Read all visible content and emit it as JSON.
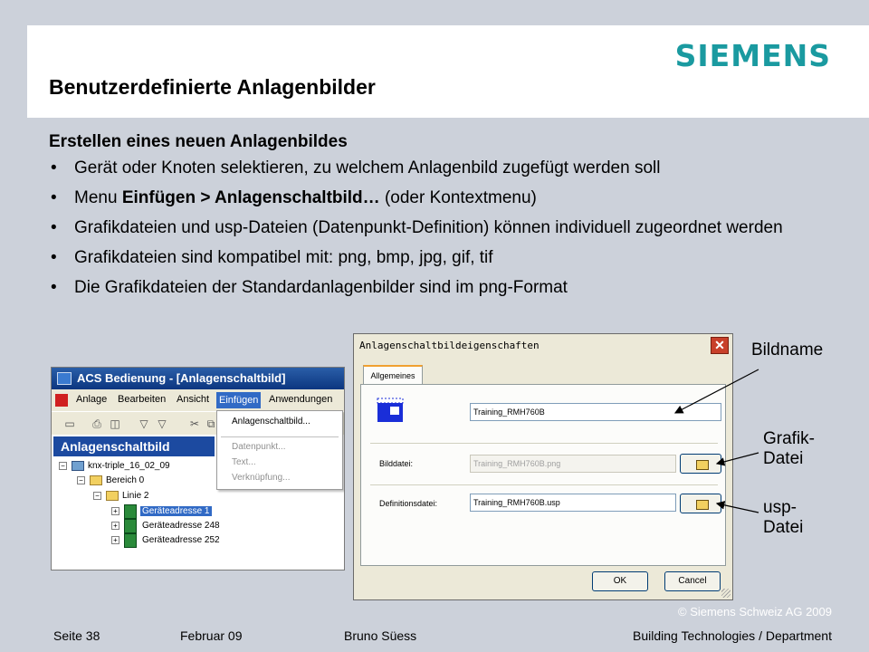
{
  "slide": {
    "logo": "SIEMENS",
    "title": "Benutzerdefinierte Anlagenbilder",
    "subtitle": "Erstellen eines neuen Anlagenbildes",
    "bullets": {
      "b1": "Gerät oder Knoten selektieren, zu welchem Anlagenbild zugefügt werden soll",
      "b2_pre": "Menu ",
      "b2_bold": "Einfügen > Anlagenschaltbild…",
      "b2_post": " (oder Kontextmenu)",
      "b3": "Grafikdateien und usp-Dateien (Datenpunkt-Definition) können individuell zugeordnet werden",
      "b4": "Grafikdateien sind kompatibel mit: png, bmp, jpg, gif, tif",
      "b5": "Die Grafikdateien der Standardanlagenbilder sind im png-Format"
    }
  },
  "acs": {
    "title": "ACS Bedienung - [Anlagenschaltbild]",
    "menu": [
      "Anlage",
      "Bearbeiten",
      "Ansicht",
      "Einfügen",
      "Anwendungen"
    ],
    "panel_title": "Anlagenschaltbild",
    "tree": {
      "root": "knx-triple_16_02_09",
      "area": "Bereich 0",
      "line": "Linie 2",
      "devices": [
        "Geräteadresse 1",
        "Geräteadresse 248",
        "Geräteadresse 252"
      ]
    },
    "dropdown": {
      "item_active": "Anlagenschaltbild...",
      "item_datapoint": "Datenpunkt...",
      "item_text": "Text...",
      "item_link": "Verknüpfung..."
    }
  },
  "dialog": {
    "title": "Anlagenschaltbildeigenschaften",
    "close": "✕",
    "tab": "Allgemeines",
    "name_value": "Training_RMH760B",
    "image_label": "Bilddatei:",
    "image_value": "Training_RMH760B.png",
    "def_label": "Definitionsdatei:",
    "def_value": "Training_RMH760B.usp",
    "ok": "OK",
    "cancel": "Cancel"
  },
  "annotations": {
    "bildname": "Bildname",
    "grafik_l1": "Grafik-",
    "grafik_l2": "Datei",
    "usp_l1": "usp-",
    "usp_l2": "Datei"
  },
  "footer": {
    "copyright": "© Siemens Schweiz AG 2009",
    "page": "Seite 38",
    "date": "Februar 09",
    "author": "Bruno Süess",
    "department": "Building Technologies / Department"
  },
  "colors": {
    "background": "#ccd1da",
    "siemens_teal": "#1a9aa0",
    "panel_blue": "#1c4aa0",
    "dialog_face": "#ece9d8"
  }
}
